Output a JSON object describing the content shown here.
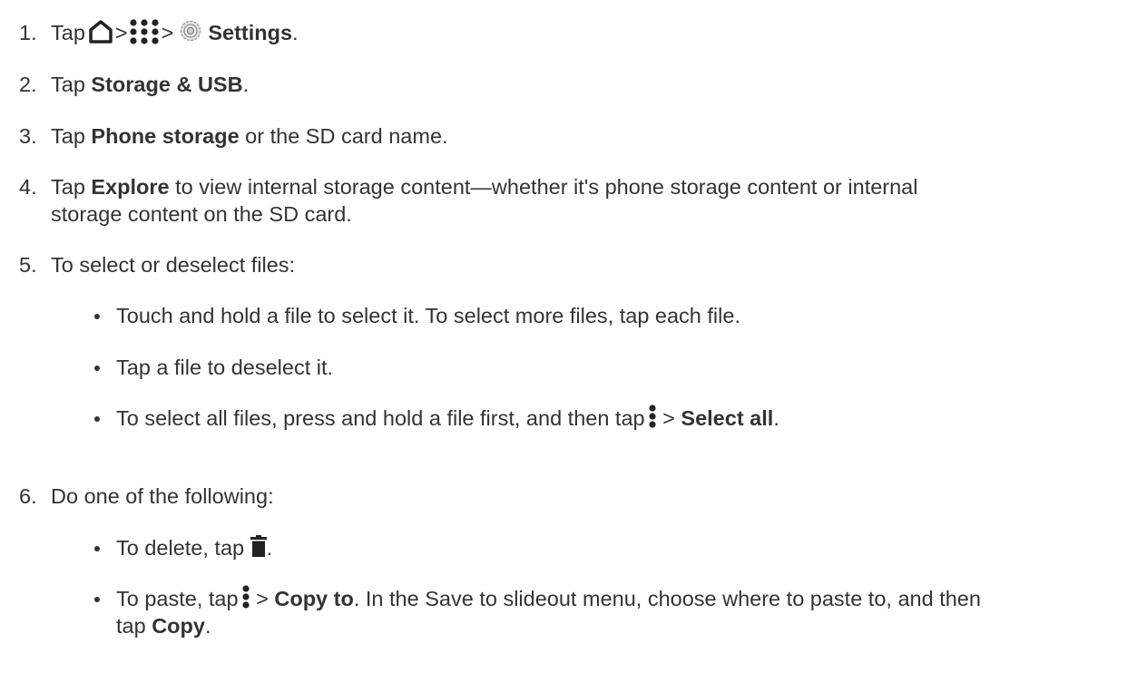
{
  "steps": [
    {
      "num": "1.",
      "pre": "Tap",
      "sep1": ">",
      "sep2": ">",
      "bold": "Settings",
      "post": "."
    },
    {
      "num": "2.",
      "pre": "Tap ",
      "bold": "Storage & USB",
      "post": "."
    },
    {
      "num": "3.",
      "pre": "Tap ",
      "bold": "Phone storage",
      "post": " or the SD card name."
    },
    {
      "num": "4.",
      "pre": "Tap ",
      "bold": "Explore",
      "post": " to view internal storage content—whether it's phone storage content or internal",
      "line2": "storage content on the SD card."
    },
    {
      "num": "5.",
      "text": "To select or deselect files:"
    },
    {
      "num": "6.",
      "text": "Do one of the following:"
    }
  ],
  "step5_bullets": [
    {
      "text": "Touch and hold a file to select it. To select more files, tap each file."
    },
    {
      "text": "Tap a file to deselect it."
    },
    {
      "pre": "To select all files, press and hold a file first, and then tap",
      "sep": " > ",
      "bold": "Select all",
      "post": "."
    }
  ],
  "step6_bullets": [
    {
      "pre": "To delete, tap ",
      "post": "."
    },
    {
      "pre": "To paste, tap",
      "sep": " > ",
      "bold": "Copy to",
      "post": ". In the Save to slideout menu, choose where to paste to, and then",
      "line2_pre": "tap ",
      "line2_bold": "Copy",
      "line2_post": "."
    }
  ],
  "icons": {
    "home": "home-icon",
    "apps": "apps-grid-icon",
    "settings": "settings-gear-icon",
    "more": "more-options-icon",
    "delete": "trash-icon"
  }
}
